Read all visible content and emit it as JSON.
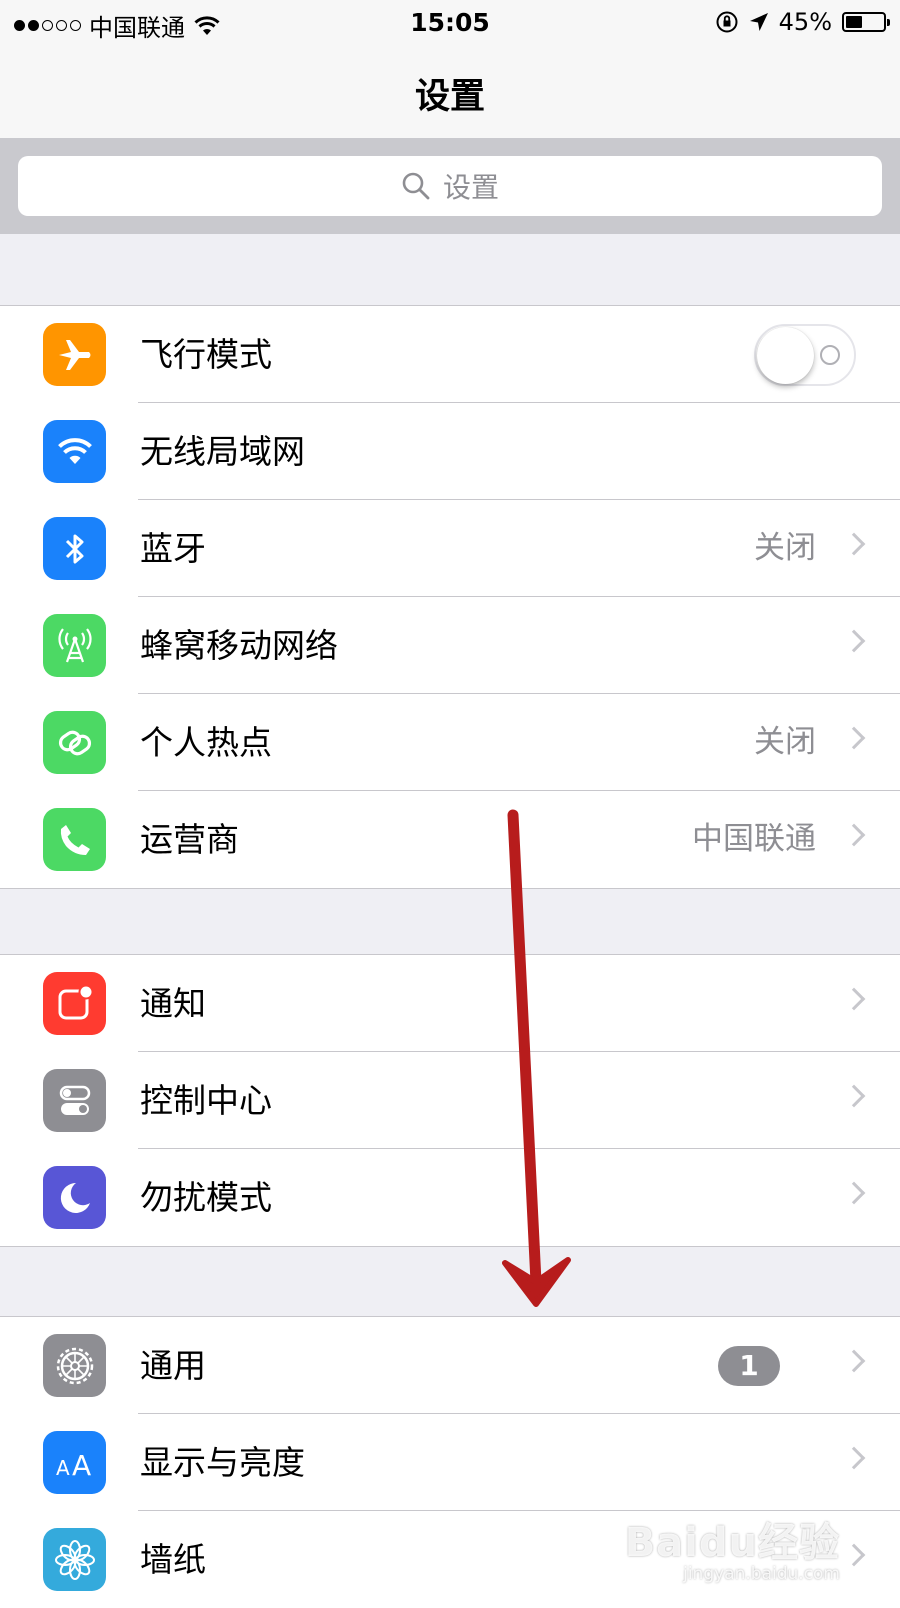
{
  "status_bar": {
    "carrier": "中国联通",
    "time": "15:05",
    "battery_percent": "45%",
    "battery_level": 0.45,
    "icons": [
      "signal-dots",
      "wifi-icon",
      "rotation-lock-icon",
      "location-icon",
      "battery-icon"
    ]
  },
  "nav": {
    "title": "设置"
  },
  "search": {
    "placeholder": "设置"
  },
  "sections": [
    {
      "rows": [
        {
          "label": "飞行模式",
          "icon": "airplane-icon",
          "icon_color": "#ff9500",
          "toggle": "off"
        },
        {
          "label": "无线局域网",
          "icon": "wifi-icon",
          "icon_color": "#1a82fb"
        },
        {
          "label": "蓝牙",
          "value": "关闭",
          "icon": "bluetooth-icon",
          "icon_color": "#1a82fb"
        },
        {
          "label": "蜂窝移动网络",
          "icon": "cellular-icon",
          "icon_color": "#4cd964"
        },
        {
          "label": "个人热点",
          "value": "关闭",
          "icon": "hotspot-icon",
          "icon_color": "#4cd964"
        },
        {
          "label": "运营商",
          "value": "中国联通",
          "icon": "phone-icon",
          "icon_color": "#4cd964"
        }
      ]
    },
    {
      "rows": [
        {
          "label": "通知",
          "icon": "notification-icon",
          "icon_color": "#ff3b30"
        },
        {
          "label": "控制中心",
          "icon": "control-center-icon",
          "icon_color": "#8e8e93"
        },
        {
          "label": "勿扰模式",
          "icon": "moon-icon",
          "icon_color": "#5856d6"
        }
      ]
    },
    {
      "rows": [
        {
          "label": "通用",
          "badge": "1",
          "icon": "gear-icon",
          "icon_color": "#8e8e93"
        },
        {
          "label": "显示与亮度",
          "icon": "display-icon",
          "icon_color": "#1a82fb"
        },
        {
          "label": "墙纸",
          "icon": "wallpaper-icon",
          "icon_color": "#34aadc"
        }
      ]
    }
  ],
  "annotation": {
    "arrow_color": "#b71c1c"
  },
  "watermark": {
    "brand": "Baidu经验",
    "url": "jingyan.baidu.com"
  }
}
